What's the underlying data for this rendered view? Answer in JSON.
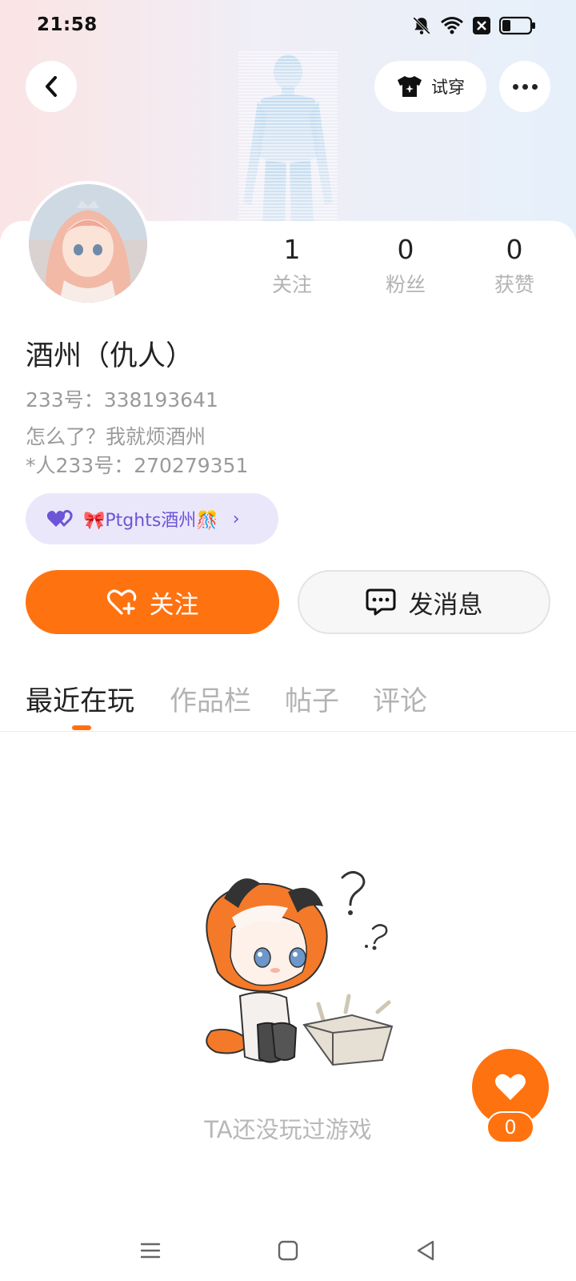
{
  "status_bar": {
    "time": "21:58",
    "icons": [
      "bell-off-icon",
      "wifi-icon",
      "close-box-icon",
      "battery-icon"
    ]
  },
  "header": {
    "try_on_label": "试穿",
    "icons": [
      "back-icon",
      "shirt-icon",
      "more-icon"
    ]
  },
  "profile": {
    "nickname": "酒州（仇人）",
    "uid_line": "233号：338193641",
    "bio_line1": "怎么了？我就烦酒州",
    "bio_line2": "*人233号：270279351",
    "badge_label": "🎀Ptghts酒州🎊",
    "badge_icon": "double-heart-icon"
  },
  "stats": [
    {
      "value": "1",
      "label": "关注"
    },
    {
      "value": "0",
      "label": "粉丝"
    },
    {
      "value": "0",
      "label": "获赞"
    }
  ],
  "actions": {
    "follow_label": "关注",
    "message_label": "发消息"
  },
  "tabs": [
    {
      "label": "最近在玩",
      "active": true
    },
    {
      "label": "作品栏",
      "active": false
    },
    {
      "label": "帖子",
      "active": false
    },
    {
      "label": "评论",
      "active": false
    }
  ],
  "empty_state": {
    "text": "TA还没玩过游戏"
  },
  "like_fab": {
    "count": "0"
  },
  "colors": {
    "accent": "#ff7210",
    "badge_bg": "#ebe7fb",
    "badge_text": "#6c55d6",
    "muted_text": "#9a9a9a"
  }
}
